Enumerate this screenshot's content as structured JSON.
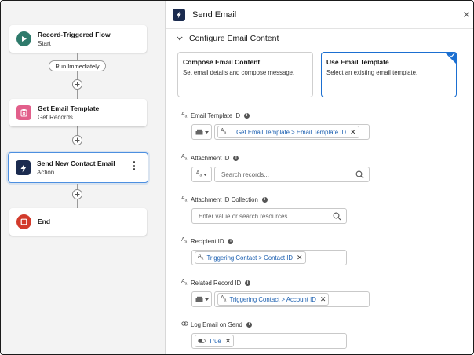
{
  "canvas": {
    "nodes": [
      {
        "title": "Record-Triggered Flow",
        "subtitle": "Start",
        "icon": "play-icon",
        "color": "#2e7a6b"
      },
      {
        "title": "Get Email Template",
        "subtitle": "Get Records",
        "icon": "get-records-icon",
        "color": "#e25f8b"
      },
      {
        "title": "Send New Contact Email",
        "subtitle": "Action",
        "icon": "lightning-icon",
        "color": "#1b2b4f"
      },
      {
        "title": "End",
        "subtitle": "",
        "icon": "stop-icon",
        "color": "#d23a2b"
      }
    ],
    "run_label": "Run Immediately"
  },
  "panel": {
    "title": "Send Email",
    "section_title": "Configure Email Content",
    "choices": [
      {
        "title": "Compose Email Content",
        "desc": "Set email details and compose message."
      },
      {
        "title": "Use Email Template",
        "desc": "Select an existing email template."
      }
    ],
    "fields": {
      "template_id": {
        "label": "Email Template ID",
        "chip": "... Get Email Template > Email Template ID"
      },
      "attachment_id": {
        "label": "Attachment ID",
        "placeholder": "Search records..."
      },
      "attachment_collection": {
        "label": "Attachment ID Collection",
        "placeholder": "Enter value or search resources..."
      },
      "recipient_id": {
        "label": "Recipient ID",
        "chip": "Triggering Contact > Contact ID"
      },
      "related_record": {
        "label": "Related Record ID",
        "chip": "Triggering Contact > Account ID"
      },
      "log_email": {
        "label": "Log Email on Send",
        "chip": "True"
      }
    },
    "type_prefix": "A",
    "type_suffix": "a"
  },
  "colors": {
    "accent": "#1b6fd1",
    "selected_border": "#4c8fe0",
    "canvas_bg": "#f3f3f3"
  }
}
